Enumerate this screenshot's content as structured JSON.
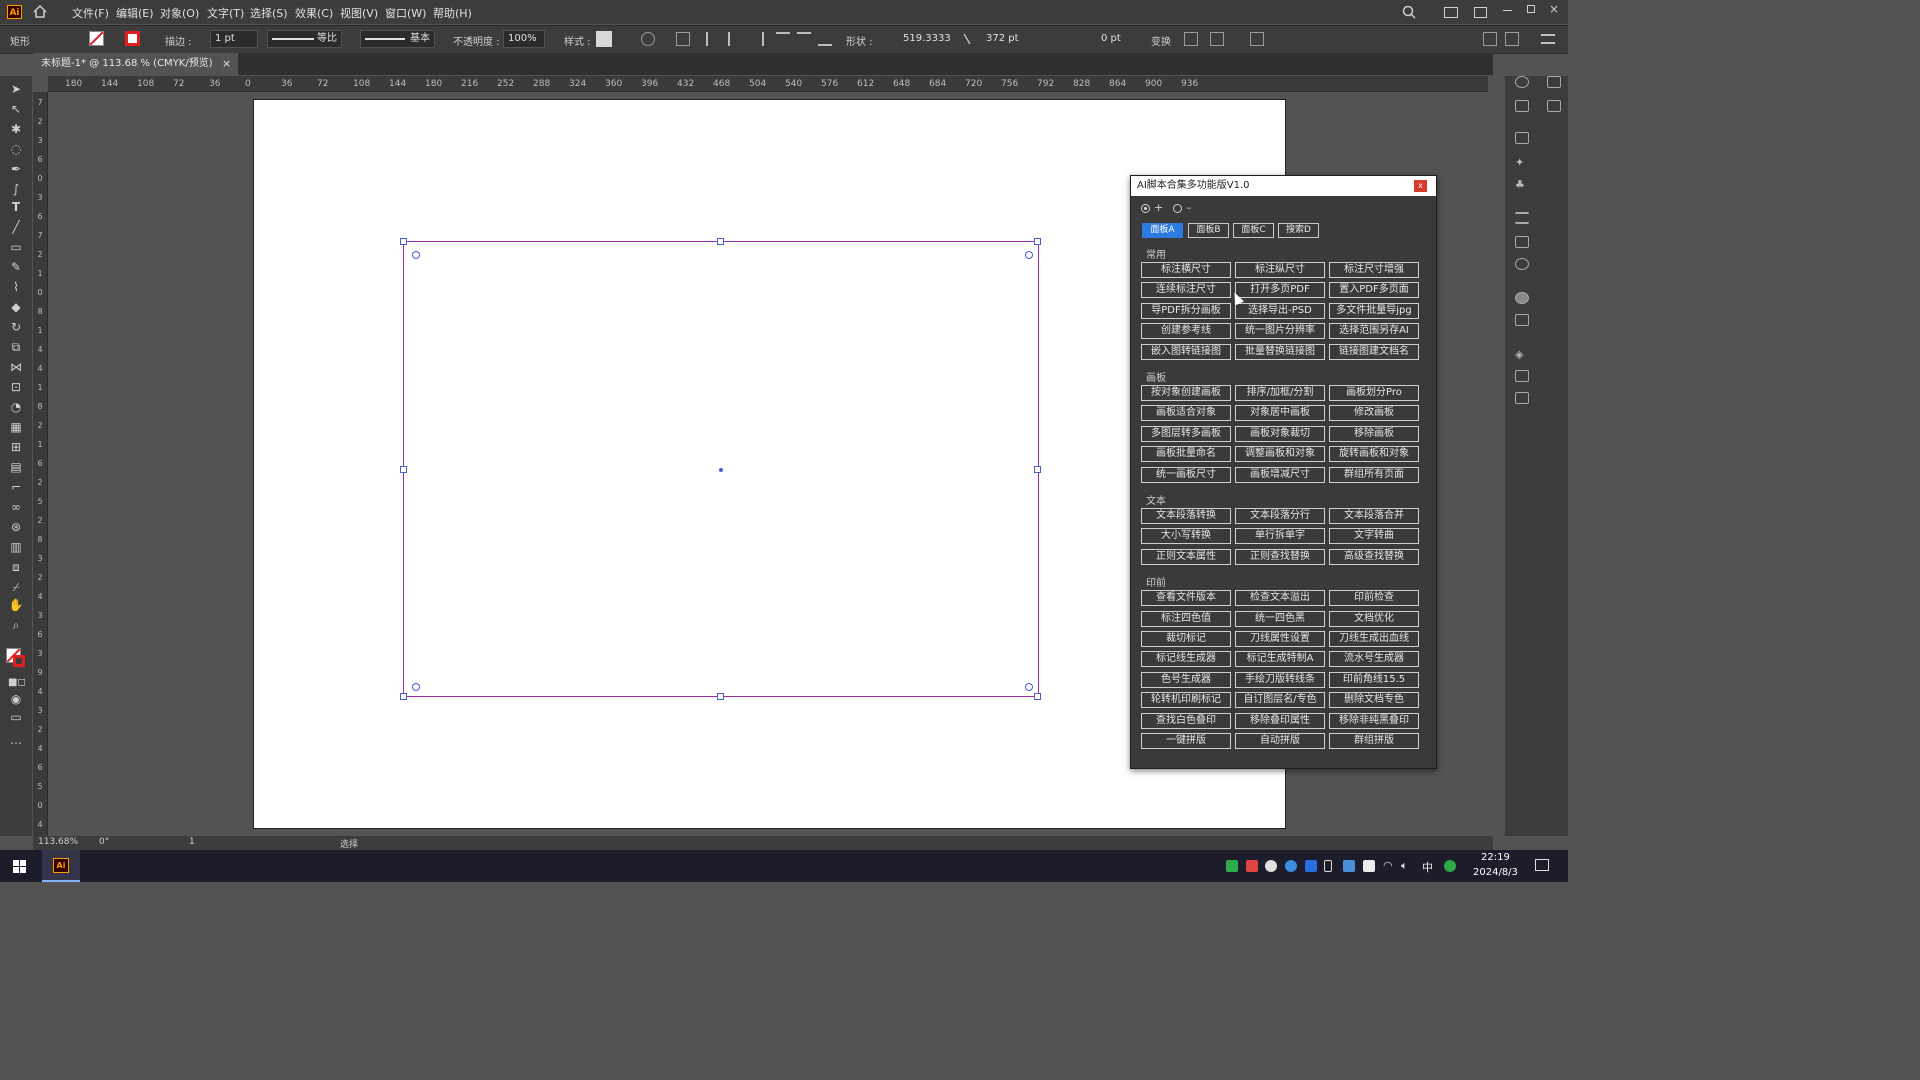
{
  "app": {
    "logo": "Ai",
    "accent": "#ff9a00"
  },
  "menu": [
    "文件(F)",
    "编辑(E)",
    "对象(O)",
    "文字(T)",
    "选择(S)",
    "效果(C)",
    "视图(V)",
    "窗口(W)",
    "帮助(H)"
  ],
  "control_bar": {
    "tool_name": "矩形",
    "stroke_label": "描边 :",
    "stroke_value": "1 pt",
    "stroke_profile": "等比",
    "brush": "基本",
    "opacity_label": "不透明度 :",
    "opacity_value": "100%",
    "style_label": "样式 :",
    "shape_label": "形状 :",
    "width": "519.3333",
    "height": "372 pt",
    "corner": "0 pt",
    "transform_label": "变换"
  },
  "document_tab": {
    "title": "未标题-1* @ 113.68 % (CMYK/预览)",
    "close": "×"
  },
  "ruler": {
    "h_labels": [
      "180",
      "144",
      "108",
      "72",
      "36",
      "0",
      "36",
      "72",
      "108",
      "144",
      "180",
      "216",
      "252",
      "288",
      "324",
      "360",
      "396",
      "432",
      "468",
      "504",
      "540",
      "576",
      "612",
      "648",
      "684",
      "720",
      "756",
      "792",
      "828",
      "864",
      "900",
      "936"
    ],
    "v_labels": [
      "7",
      "2",
      "3",
      "6",
      "0",
      "3",
      "6",
      "7",
      "2",
      "1",
      "0",
      "8",
      "1",
      "4",
      "4",
      "1",
      "8",
      "2",
      "1",
      "6",
      "2",
      "5",
      "2",
      "8",
      "3",
      "2",
      "4",
      "3",
      "6",
      "3",
      "9",
      "4",
      "3",
      "2",
      "4",
      "6",
      "5",
      "0",
      "4"
    ]
  },
  "panel": {
    "title": "AI脚本合集多功能版V1.0",
    "close": "x",
    "radio_plus": "+",
    "radio_minus": "–",
    "tabs": [
      "面板A",
      "面板B",
      "面板C",
      "搜索D"
    ],
    "active_tab": 0,
    "sections": [
      {
        "label": "常用",
        "buttons": [
          "标注横尺寸",
          "标注纵尺寸",
          "标注尺寸增强",
          "连续标注尺寸",
          "打开多页PDF",
          "置入PDF多页面",
          "导PDF拆分画板",
          "选择导出-PSD",
          "多文件批量导jpg",
          "创建参考线",
          "统一图片分辨率",
          "选择范围另存AI",
          "嵌入图转链接图",
          "批量替换链接图",
          "链接图建文档名"
        ]
      },
      {
        "label": "画板",
        "buttons": [
          "按对象创建画板",
          "排序/加框/分割",
          "画板划分Pro",
          "画板适合对象",
          "对象居中画板",
          "修改画板",
          "多图层转多画板",
          "画板对象裁切",
          "移除画板",
          "画板批量命名",
          "调整画板和对象",
          "旋转画板和对象",
          "统一画板尺寸",
          "画板增减尺寸",
          "群组所有页面"
        ]
      },
      {
        "label": "文本",
        "buttons": [
          "文本段落转换",
          "文本段落分行",
          "文本段落合并",
          "大小写转换",
          "单行拆单字",
          "文字转曲",
          "正则文本属性",
          "正则查找替换",
          "高级查找替换"
        ]
      },
      {
        "label": "印前",
        "buttons": [
          "查看文件版本",
          "检查文本溢出",
          "印前检查",
          "标注四色值",
          "统一四色黑",
          "文档优化",
          "裁切标记",
          "刀线属性设置",
          "刀线生成出血线",
          "标记线生成器",
          "标记生成特制A",
          "流水号生成器",
          "色号生成器",
          "手绘刀版转线条",
          "印前角线15.5",
          "轮转机印刷标记",
          "自订图层名/专色",
          "删除文档专色",
          "查找白色叠印",
          "移除叠印属性",
          "移除非纯黑叠印",
          "一键拼版",
          "自动拼版",
          "群组拼版"
        ]
      }
    ]
  },
  "status": {
    "zoom": "113.68%",
    "rotation": "0°",
    "page": "1",
    "tool": "选择"
  },
  "taskbar": {
    "time": "22:19",
    "date": "2024/8/3",
    "ime": "中",
    "app_icon": "Ai"
  },
  "colors": {
    "selection": "#9b2ea6",
    "handles": "#4a5bd6",
    "active_tab": "#2d7be0",
    "close_button": "#d83a2e"
  }
}
